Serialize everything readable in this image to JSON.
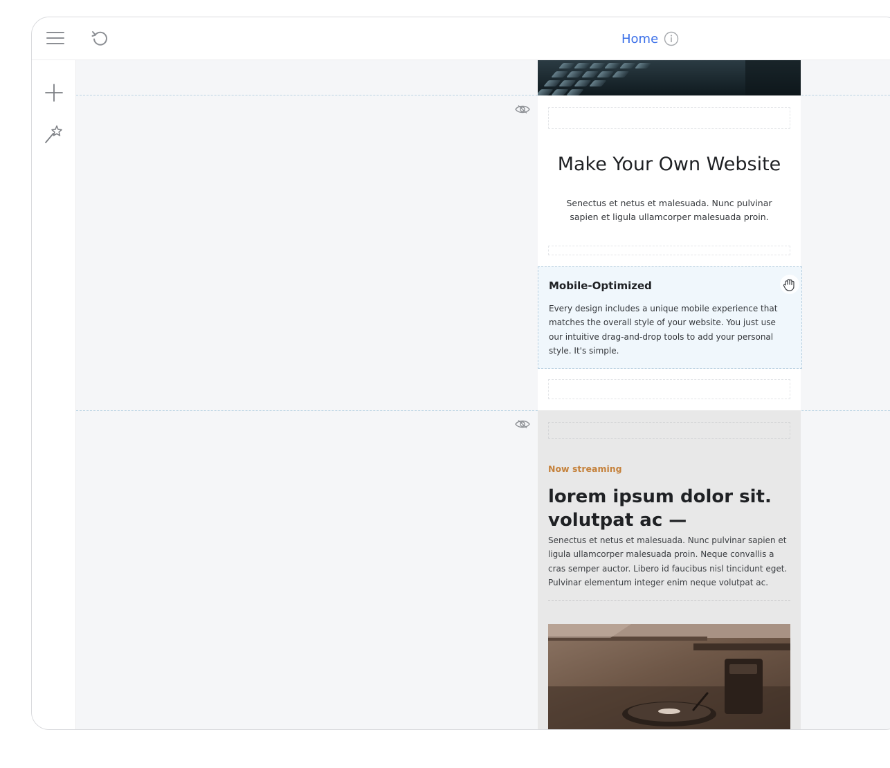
{
  "header": {
    "page_title": "Home",
    "icons": {
      "menu": "menu-icon",
      "undo": "undo-icon",
      "info": "info-icon"
    }
  },
  "toolbar": {
    "icons": {
      "add": "plus-icon",
      "design": "magic-wand-icon"
    }
  },
  "canvas": {
    "section_visibility_icon": "eye-icon",
    "hero": {
      "title": "Make Your Own Website",
      "text": "Senectus et netus et malesuada. Nunc pulvinar sapien et ligula ullamcorper malesuada proin."
    },
    "feature_block": {
      "title": "Mobile-Optimized",
      "text": "Every design includes a unique mobile experience that matches the overall style of your website. You just use our intuitive drag-and-drop tools to add your personal style. It's simple.",
      "drag_icon": "grab-hand-icon"
    },
    "streaming": {
      "eyebrow": "Now streaming",
      "title": "lorem ipsum dolor sit. volutpat ac —",
      "text": "Senectus et netus et malesuada. Nunc pulvinar sapien et ligula ullamcorper malesuada proin. Neque convallis a cras semper auctor. Libero id faucibus nisl tincidunt eget. Pulvinar elementum integer enim neque volutpat ac."
    }
  },
  "colors": {
    "accent": "#3a6fe8",
    "eyebrow": "#c5823c",
    "selection_bg": "#f0f7fc",
    "guide_line": "#b9d3e3"
  }
}
